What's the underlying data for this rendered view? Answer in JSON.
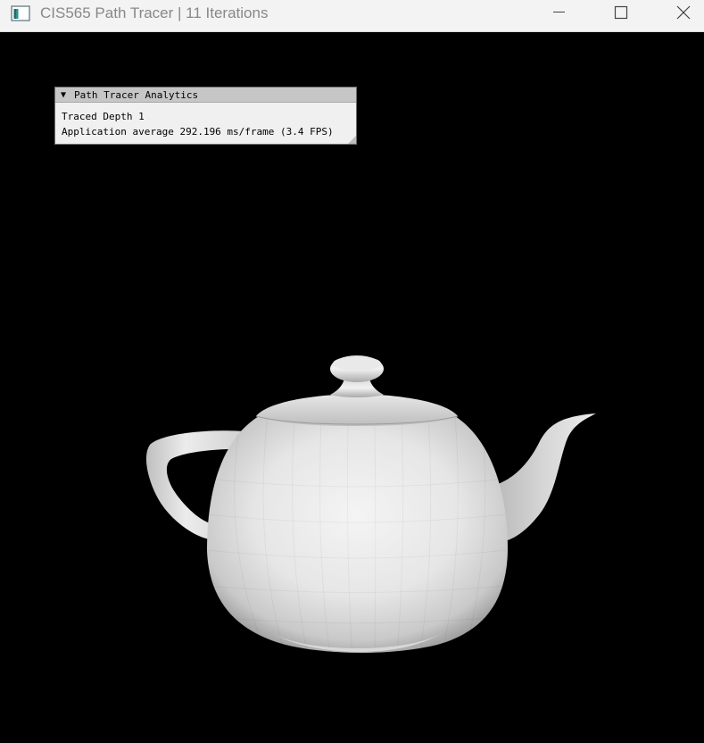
{
  "window": {
    "title": "CIS565 Path Tracer | 11 Iterations",
    "app_icon": "app-window-icon",
    "controls": {
      "minimize_icon": "minimize-icon",
      "maximize_icon": "maximize-icon",
      "close_icon": "close-icon"
    }
  },
  "analytics_panel": {
    "collapse_glyph": "▼",
    "title": "Path Tracer Analytics",
    "traced_depth_line": "Traced Depth 1",
    "average_line": "Application average 292.196 ms/frame (3.4 FPS)"
  },
  "render": {
    "background_color": "#000000",
    "object": "teapot",
    "object_color": "#e6e6e6"
  }
}
